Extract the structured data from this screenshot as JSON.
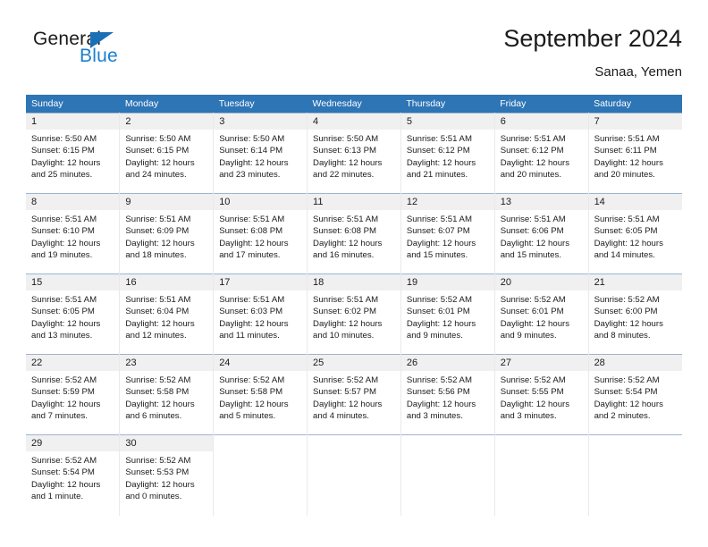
{
  "brand": {
    "name_top": "General",
    "name_bottom": "Blue",
    "logo_icon": "blue-triangle-icon",
    "accent_color": "#1b7fd0"
  },
  "header": {
    "title": "September 2024",
    "subtitle": "Sanaa, Yemen"
  },
  "calendar": {
    "header_bg": "#2e75b6",
    "daynum_bg": "#f0f0f0",
    "weekdays": [
      "Sunday",
      "Monday",
      "Tuesday",
      "Wednesday",
      "Thursday",
      "Friday",
      "Saturday"
    ],
    "weeks": [
      [
        {
          "day": "1",
          "sunrise": "Sunrise: 5:50 AM",
          "sunset": "Sunset: 6:15 PM",
          "daylight1": "Daylight: 12 hours",
          "daylight2": "and 25 minutes."
        },
        {
          "day": "2",
          "sunrise": "Sunrise: 5:50 AM",
          "sunset": "Sunset: 6:15 PM",
          "daylight1": "Daylight: 12 hours",
          "daylight2": "and 24 minutes."
        },
        {
          "day": "3",
          "sunrise": "Sunrise: 5:50 AM",
          "sunset": "Sunset: 6:14 PM",
          "daylight1": "Daylight: 12 hours",
          "daylight2": "and 23 minutes."
        },
        {
          "day": "4",
          "sunrise": "Sunrise: 5:50 AM",
          "sunset": "Sunset: 6:13 PM",
          "daylight1": "Daylight: 12 hours",
          "daylight2": "and 22 minutes."
        },
        {
          "day": "5",
          "sunrise": "Sunrise: 5:51 AM",
          "sunset": "Sunset: 6:12 PM",
          "daylight1": "Daylight: 12 hours",
          "daylight2": "and 21 minutes."
        },
        {
          "day": "6",
          "sunrise": "Sunrise: 5:51 AM",
          "sunset": "Sunset: 6:12 PM",
          "daylight1": "Daylight: 12 hours",
          "daylight2": "and 20 minutes."
        },
        {
          "day": "7",
          "sunrise": "Sunrise: 5:51 AM",
          "sunset": "Sunset: 6:11 PM",
          "daylight1": "Daylight: 12 hours",
          "daylight2": "and 20 minutes."
        }
      ],
      [
        {
          "day": "8",
          "sunrise": "Sunrise: 5:51 AM",
          "sunset": "Sunset: 6:10 PM",
          "daylight1": "Daylight: 12 hours",
          "daylight2": "and 19 minutes."
        },
        {
          "day": "9",
          "sunrise": "Sunrise: 5:51 AM",
          "sunset": "Sunset: 6:09 PM",
          "daylight1": "Daylight: 12 hours",
          "daylight2": "and 18 minutes."
        },
        {
          "day": "10",
          "sunrise": "Sunrise: 5:51 AM",
          "sunset": "Sunset: 6:08 PM",
          "daylight1": "Daylight: 12 hours",
          "daylight2": "and 17 minutes."
        },
        {
          "day": "11",
          "sunrise": "Sunrise: 5:51 AM",
          "sunset": "Sunset: 6:08 PM",
          "daylight1": "Daylight: 12 hours",
          "daylight2": "and 16 minutes."
        },
        {
          "day": "12",
          "sunrise": "Sunrise: 5:51 AM",
          "sunset": "Sunset: 6:07 PM",
          "daylight1": "Daylight: 12 hours",
          "daylight2": "and 15 minutes."
        },
        {
          "day": "13",
          "sunrise": "Sunrise: 5:51 AM",
          "sunset": "Sunset: 6:06 PM",
          "daylight1": "Daylight: 12 hours",
          "daylight2": "and 15 minutes."
        },
        {
          "day": "14",
          "sunrise": "Sunrise: 5:51 AM",
          "sunset": "Sunset: 6:05 PM",
          "daylight1": "Daylight: 12 hours",
          "daylight2": "and 14 minutes."
        }
      ],
      [
        {
          "day": "15",
          "sunrise": "Sunrise: 5:51 AM",
          "sunset": "Sunset: 6:05 PM",
          "daylight1": "Daylight: 12 hours",
          "daylight2": "and 13 minutes."
        },
        {
          "day": "16",
          "sunrise": "Sunrise: 5:51 AM",
          "sunset": "Sunset: 6:04 PM",
          "daylight1": "Daylight: 12 hours",
          "daylight2": "and 12 minutes."
        },
        {
          "day": "17",
          "sunrise": "Sunrise: 5:51 AM",
          "sunset": "Sunset: 6:03 PM",
          "daylight1": "Daylight: 12 hours",
          "daylight2": "and 11 minutes."
        },
        {
          "day": "18",
          "sunrise": "Sunrise: 5:51 AM",
          "sunset": "Sunset: 6:02 PM",
          "daylight1": "Daylight: 12 hours",
          "daylight2": "and 10 minutes."
        },
        {
          "day": "19",
          "sunrise": "Sunrise: 5:52 AM",
          "sunset": "Sunset: 6:01 PM",
          "daylight1": "Daylight: 12 hours",
          "daylight2": "and 9 minutes."
        },
        {
          "day": "20",
          "sunrise": "Sunrise: 5:52 AM",
          "sunset": "Sunset: 6:01 PM",
          "daylight1": "Daylight: 12 hours",
          "daylight2": "and 9 minutes."
        },
        {
          "day": "21",
          "sunrise": "Sunrise: 5:52 AM",
          "sunset": "Sunset: 6:00 PM",
          "daylight1": "Daylight: 12 hours",
          "daylight2": "and 8 minutes."
        }
      ],
      [
        {
          "day": "22",
          "sunrise": "Sunrise: 5:52 AM",
          "sunset": "Sunset: 5:59 PM",
          "daylight1": "Daylight: 12 hours",
          "daylight2": "and 7 minutes."
        },
        {
          "day": "23",
          "sunrise": "Sunrise: 5:52 AM",
          "sunset": "Sunset: 5:58 PM",
          "daylight1": "Daylight: 12 hours",
          "daylight2": "and 6 minutes."
        },
        {
          "day": "24",
          "sunrise": "Sunrise: 5:52 AM",
          "sunset": "Sunset: 5:58 PM",
          "daylight1": "Daylight: 12 hours",
          "daylight2": "and 5 minutes."
        },
        {
          "day": "25",
          "sunrise": "Sunrise: 5:52 AM",
          "sunset": "Sunset: 5:57 PM",
          "daylight1": "Daylight: 12 hours",
          "daylight2": "and 4 minutes."
        },
        {
          "day": "26",
          "sunrise": "Sunrise: 5:52 AM",
          "sunset": "Sunset: 5:56 PM",
          "daylight1": "Daylight: 12 hours",
          "daylight2": "and 3 minutes."
        },
        {
          "day": "27",
          "sunrise": "Sunrise: 5:52 AM",
          "sunset": "Sunset: 5:55 PM",
          "daylight1": "Daylight: 12 hours",
          "daylight2": "and 3 minutes."
        },
        {
          "day": "28",
          "sunrise": "Sunrise: 5:52 AM",
          "sunset": "Sunset: 5:54 PM",
          "daylight1": "Daylight: 12 hours",
          "daylight2": "and 2 minutes."
        }
      ],
      [
        {
          "day": "29",
          "sunrise": "Sunrise: 5:52 AM",
          "sunset": "Sunset: 5:54 PM",
          "daylight1": "Daylight: 12 hours",
          "daylight2": "and 1 minute."
        },
        {
          "day": "30",
          "sunrise": "Sunrise: 5:52 AM",
          "sunset": "Sunset: 5:53 PM",
          "daylight1": "Daylight: 12 hours",
          "daylight2": "and 0 minutes."
        },
        {
          "day": "",
          "sunrise": "",
          "sunset": "",
          "daylight1": "",
          "daylight2": ""
        },
        {
          "day": "",
          "sunrise": "",
          "sunset": "",
          "daylight1": "",
          "daylight2": ""
        },
        {
          "day": "",
          "sunrise": "",
          "sunset": "",
          "daylight1": "",
          "daylight2": ""
        },
        {
          "day": "",
          "sunrise": "",
          "sunset": "",
          "daylight1": "",
          "daylight2": ""
        },
        {
          "day": "",
          "sunrise": "",
          "sunset": "",
          "daylight1": "",
          "daylight2": ""
        }
      ]
    ]
  }
}
